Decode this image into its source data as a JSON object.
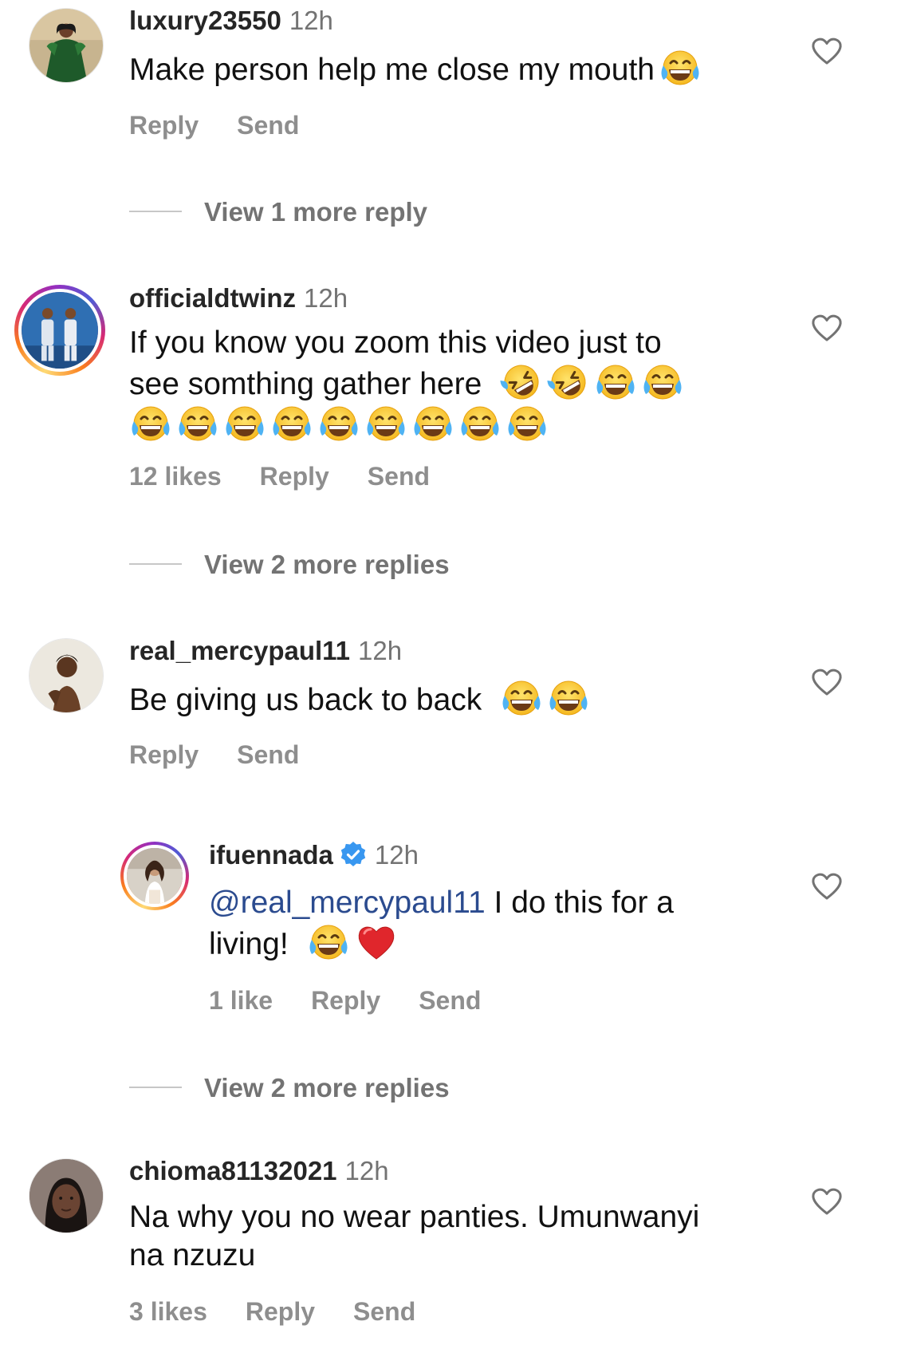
{
  "comments": [
    {
      "username": "luxury23550",
      "time": "12h",
      "text": "Make person help me close my mouth",
      "likes": "",
      "reply": "Reply",
      "send": "Send",
      "view_more": "View 1 more reply"
    },
    {
      "username": "officialdtwinz",
      "time": "12h",
      "text_line1": "If you know you zoom this video just to",
      "text_line2": "see somthing gather here",
      "likes": "12 likes",
      "reply": "Reply",
      "send": "Send",
      "view_more": "View 2 more replies"
    },
    {
      "username": "real_mercypaul11",
      "time": "12h",
      "text": "Be giving us back to back",
      "reply": "Reply",
      "send": "Send"
    },
    {
      "username": "ifuennada",
      "time": "12h",
      "mention": "@real_mercypaul11",
      "text_line1_rest": " I do this for a",
      "text_line2": "living!",
      "likes": "1 like",
      "reply": "Reply",
      "send": "Send",
      "view_more": "View 2 more replies"
    },
    {
      "username": "chioma81132021",
      "time": "12h",
      "text_line1": "Na why you no wear panties. Umunwanyi",
      "text_line2": "na nzuzu",
      "likes": "3 likes",
      "reply": "Reply",
      "send": "Send"
    }
  ],
  "icons": {
    "like": "heart-outline-icon",
    "verified": "verified-badge-icon",
    "emoji_laugh": "face-with-tears-of-joy-emoji",
    "emoji_rofl": "rolling-on-floor-laughing-emoji",
    "emoji_heart": "red-heart-emoji"
  },
  "colors": {
    "username": "#262626",
    "meta": "#737373",
    "mention": "#2b4b8f",
    "verified": "#3897f0"
  }
}
